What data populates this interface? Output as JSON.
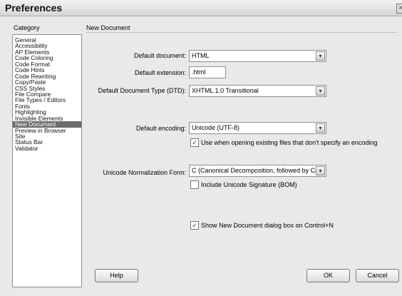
{
  "window": {
    "title": "Preferences"
  },
  "category": {
    "header": "Category",
    "items": [
      {
        "label": "General",
        "selected": false
      },
      {
        "label": "Accessibility",
        "selected": false
      },
      {
        "label": "AP Elements",
        "selected": false
      },
      {
        "label": "Code Coloring",
        "selected": false
      },
      {
        "label": "Code Format",
        "selected": false
      },
      {
        "label": "Code Hints",
        "selected": false
      },
      {
        "label": "Code Rewriting",
        "selected": false
      },
      {
        "label": "Copy/Paste",
        "selected": false
      },
      {
        "label": "CSS Styles",
        "selected": false
      },
      {
        "label": "File Compare",
        "selected": false
      },
      {
        "label": "File Types / Editors",
        "selected": false
      },
      {
        "label": "Fonts",
        "selected": false
      },
      {
        "label": "Highlighting",
        "selected": false
      },
      {
        "label": "Invisible Elements",
        "selected": false
      },
      {
        "label": "New Document",
        "selected": true
      },
      {
        "label": "Preview in Browser",
        "selected": false
      },
      {
        "label": "Site",
        "selected": false
      },
      {
        "label": "Status Bar",
        "selected": false
      },
      {
        "label": "Validator",
        "selected": false
      }
    ]
  },
  "panel": {
    "title": "New Document",
    "default_document": {
      "label": "Default document:",
      "value": "HTML"
    },
    "default_extension": {
      "label": "Default extension:",
      "value": ".html"
    },
    "default_doctype": {
      "label": "Default Document Type (DTD):",
      "value": "XHTML 1.0 Transitional"
    },
    "default_encoding": {
      "label": "Default encoding:",
      "value": "Unicode (UTF-8)"
    },
    "use_encoding_check": {
      "label": "Use when opening existing files that don't specify an encoding",
      "checked": true
    },
    "normalization": {
      "label": "Unicode Normalization Form:",
      "value": "C (Canonical Decomposition, followed by Canonical Composition)"
    },
    "unicode_signature_check": {
      "label": "Include Unicode Signature (BOM)",
      "checked": false
    },
    "show_dialog_check": {
      "label": "Show New Document dialog box on Control+N",
      "checked": true
    }
  },
  "buttons": {
    "help": "Help",
    "ok": "OK",
    "cancel": "Cancel"
  },
  "glyphs": {
    "checkmark": "✓",
    "dropdown": "▾",
    "close": "×"
  }
}
